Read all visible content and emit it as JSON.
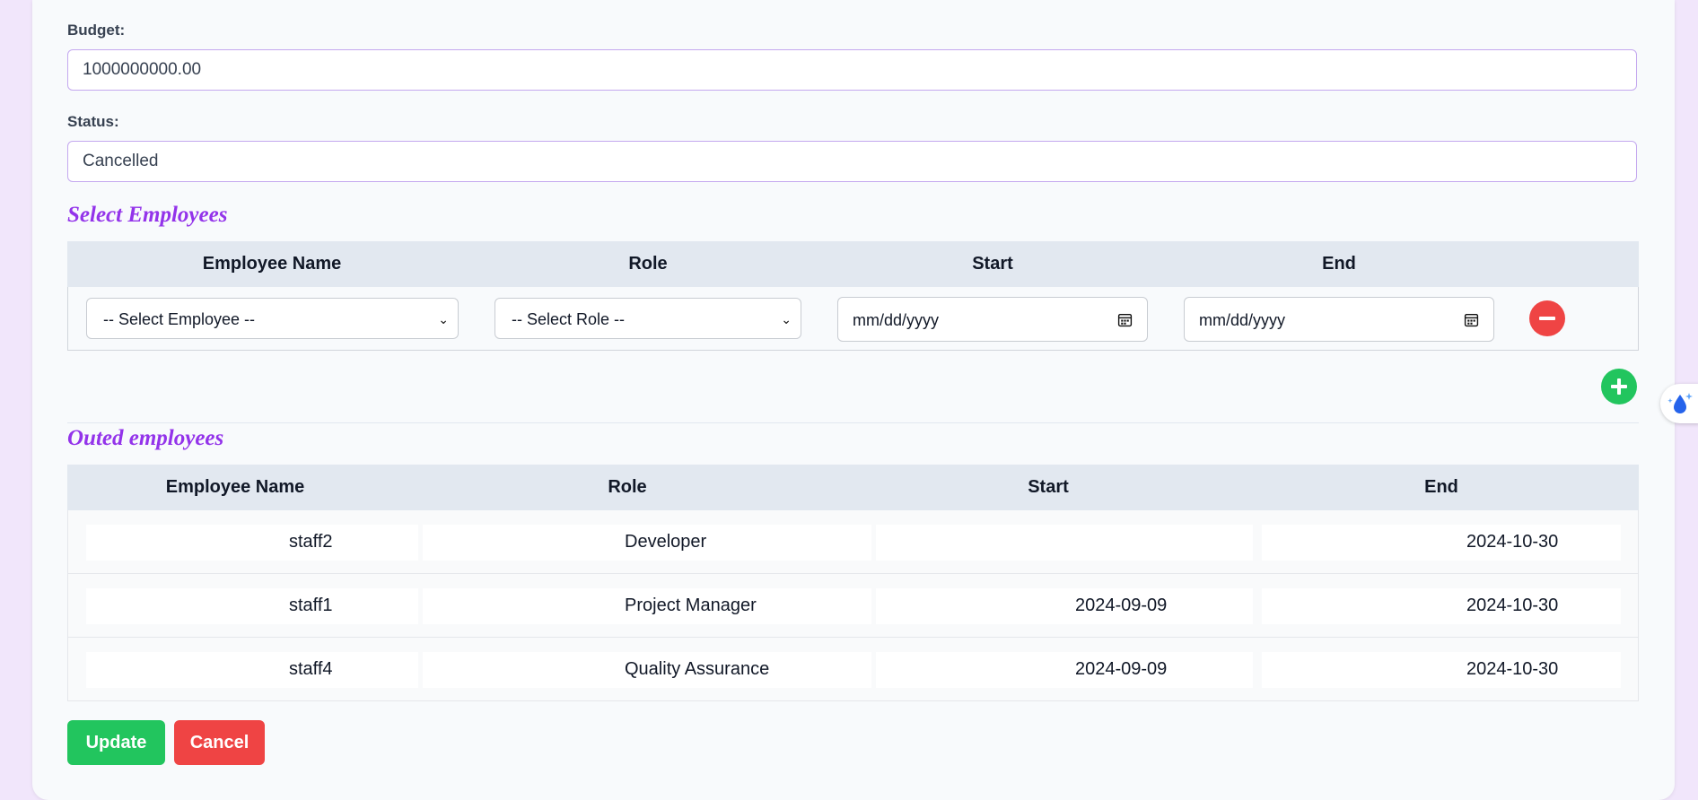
{
  "form": {
    "budget_label": "Budget:",
    "budget_value": "1000000000.00",
    "status_label": "Status:",
    "status_value": "Cancelled"
  },
  "select_employees": {
    "title": "Select Employees",
    "headers": [
      "Employee Name",
      "Role",
      "Start",
      "End"
    ],
    "employee_placeholder": "-- Select Employee --",
    "role_placeholder": "-- Select Role --",
    "start_placeholder": "mm/dd/yyyy",
    "end_placeholder": "mm/dd/yyyy"
  },
  "outed_employees": {
    "title": "Outed employees",
    "headers": [
      "Employee Name",
      "Role",
      "Start",
      "End"
    ],
    "rows": [
      {
        "name": "staff2",
        "role": "Developer",
        "start": "",
        "end": "2024-10-30"
      },
      {
        "name": "staff1",
        "role": "Project Manager",
        "start": "2024-09-09",
        "end": "2024-10-30"
      },
      {
        "name": "staff4",
        "role": "Quality Assurance",
        "start": "2024-09-09",
        "end": "2024-10-30"
      }
    ]
  },
  "actions": {
    "update_label": "Update",
    "cancel_label": "Cancel"
  },
  "colors": {
    "accent": "#9333ea",
    "update": "#22c55e",
    "cancel": "#ef4444"
  },
  "icons": {
    "remove": "minus-circle-icon",
    "add": "plus-circle-icon",
    "calendar": "calendar-icon",
    "side_widget": "water-drop-sparkle-icon"
  }
}
